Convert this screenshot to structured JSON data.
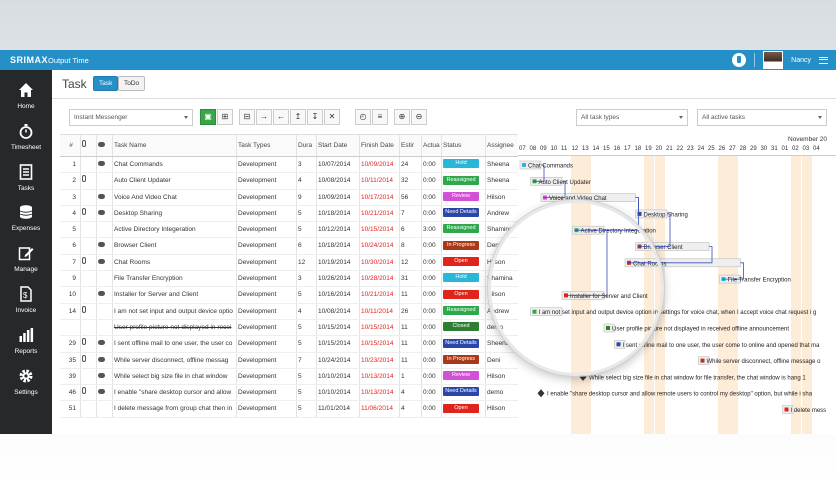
{
  "header": {
    "brand": "SRIMAX",
    "app_name": "Output Time",
    "user_name": "Nancy",
    "bell_icon": "notification-icon",
    "menu_icon": "hamburger-icon"
  },
  "sidebar": {
    "items": [
      {
        "label": "Home",
        "icon": "home-icon"
      },
      {
        "label": "Timesheet",
        "icon": "stopwatch-icon"
      },
      {
        "label": "Tasks",
        "icon": "tasks-icon"
      },
      {
        "label": "Expenses",
        "icon": "coins-icon"
      },
      {
        "label": "Manage",
        "icon": "edit-icon"
      },
      {
        "label": "Invoice",
        "icon": "invoice-icon"
      },
      {
        "label": "Reports",
        "icon": "bar-chart-icon"
      },
      {
        "label": "Settings",
        "icon": "gear-icon"
      }
    ]
  },
  "page": {
    "title": "Task",
    "tabs": [
      {
        "label": "Task",
        "active": true
      },
      {
        "label": "ToDo",
        "active": false
      }
    ]
  },
  "filters": {
    "project": "Instant Messenger",
    "task_types": "All task types",
    "task_status": "All active tasks"
  },
  "toolbar": {
    "buttons": [
      "save-icon",
      "export-icon",
      "print-icon",
      "indent-icon",
      "outdent-icon",
      "move-up-icon",
      "move-down-icon",
      "delete-icon",
      "clock-icon",
      "gantt-icon",
      "zoom-in-icon",
      "zoom-out-icon"
    ],
    "glyphs": [
      "▣",
      "⊞",
      "⊟",
      "→",
      "←",
      "↥",
      "↧",
      "✕",
      "◴",
      "≡",
      "⊕",
      "⊖"
    ]
  },
  "grid": {
    "columns": [
      "#",
      "",
      "",
      "Task Name",
      "Task Types",
      "Dura",
      "Start Date",
      "Finish Date",
      "Estir",
      "Actua",
      "Status",
      "Assignee"
    ],
    "rows": [
      {
        "id": "1",
        "clip": false,
        "chat": true,
        "name": "Chat Commands",
        "type": "Development",
        "dur": "3",
        "start": "10/07/2014",
        "finish": "10/09/2014",
        "est": "24",
        "actual": "0:00",
        "status": "Hold",
        "assignee": "Sheena",
        "strike": false
      },
      {
        "id": "2",
        "clip": true,
        "chat": false,
        "name": "Auto Client Updater",
        "type": "Development",
        "dur": "4",
        "start": "10/08/2014",
        "finish": "10/11/2014",
        "est": "32",
        "actual": "0:00",
        "status": "Reassigned",
        "assignee": "Sheena",
        "strike": false
      },
      {
        "id": "3",
        "clip": false,
        "chat": true,
        "name": "Voice And Video Chat",
        "type": "Development",
        "dur": "9",
        "start": "10/09/2014",
        "finish": "10/17/2014",
        "est": "56",
        "actual": "0:00",
        "status": "Review",
        "assignee": "Hilson",
        "strike": false
      },
      {
        "id": "4",
        "clip": true,
        "chat": true,
        "name": "Desktop Sharing",
        "type": "Development",
        "dur": "5",
        "start": "10/18/2014",
        "finish": "10/21/2014",
        "est": "7",
        "actual": "0:00",
        "status": "Need Details",
        "assignee": "Andrew",
        "strike": false
      },
      {
        "id": "5",
        "clip": false,
        "chat": false,
        "name": "Active Directory Integeration",
        "type": "Development",
        "dur": "5",
        "start": "10/12/2014",
        "finish": "10/15/2014",
        "est": "6",
        "actual": "3:00",
        "status": "Reassigned",
        "assignee": "Shamina",
        "strike": false
      },
      {
        "id": "6",
        "clip": false,
        "chat": true,
        "name": "Browser Client",
        "type": "Development",
        "dur": "6",
        "start": "10/18/2014",
        "finish": "10/24/2014",
        "est": "8",
        "actual": "0:00",
        "status": "In Progress",
        "assignee": "Deni",
        "strike": false
      },
      {
        "id": "7",
        "clip": true,
        "chat": true,
        "name": "Chat Rooms",
        "type": "Development",
        "dur": "12",
        "start": "10/19/2014",
        "finish": "10/30/2014",
        "est": "12",
        "actual": "0:00",
        "status": "Open",
        "assignee": "Hilson",
        "strike": false
      },
      {
        "id": "9",
        "clip": false,
        "chat": false,
        "name": "File Transfer Encryption",
        "type": "Development",
        "dur": "3",
        "start": "10/26/2014",
        "finish": "10/28/2014",
        "est": "31",
        "actual": "0:00",
        "status": "Hold",
        "assignee": "Shamina",
        "strike": false
      },
      {
        "id": "10",
        "clip": false,
        "chat": true,
        "name": "Installer for Server and Client",
        "type": "Development",
        "dur": "5",
        "start": "10/16/2014",
        "finish": "10/21/2014",
        "est": "11",
        "actual": "0:00",
        "status": "Open",
        "assignee": "Hilson",
        "strike": false
      },
      {
        "id": "14",
        "clip": true,
        "chat": false,
        "name": "I am not set input and output device optio",
        "type": "Development",
        "dur": "4",
        "start": "10/08/2014",
        "finish": "10/11/2014",
        "est": "26",
        "actual": "0:00",
        "status": "Reassigned",
        "assignee": "Andrew",
        "strike": false
      },
      {
        "id": "",
        "clip": false,
        "chat": false,
        "name": "User profile picture not displayed in recei",
        "type": "Development",
        "dur": "5",
        "start": "10/15/2014",
        "finish": "10/15/2014",
        "est": "11",
        "actual": "0:00",
        "status": "Closed",
        "assignee": "demo",
        "strike": true
      },
      {
        "id": "29",
        "clip": true,
        "chat": true,
        "name": "I sent offline mail to one user, the user co",
        "type": "Development",
        "dur": "5",
        "start": "10/15/2014",
        "finish": "10/15/2014",
        "est": "11",
        "actual": "0:00",
        "status": "Need Details",
        "assignee": "Sheena",
        "strike": false
      },
      {
        "id": "35",
        "clip": true,
        "chat": true,
        "name": "While server disconnect, offline messag",
        "type": "Development",
        "dur": "7",
        "start": "10/24/2014",
        "finish": "10/23/2014",
        "est": "11",
        "actual": "0:00",
        "status": "In Progress",
        "assignee": "Deni",
        "strike": false
      },
      {
        "id": "39",
        "clip": false,
        "chat": true,
        "name": "While select big size file in chat window",
        "type": "Development",
        "dur": "5",
        "start": "10/10/2014",
        "finish": "10/13/2014",
        "est": "1",
        "actual": "0:00",
        "status": "Review",
        "assignee": "Hilson",
        "strike": false
      },
      {
        "id": "46",
        "clip": true,
        "chat": true,
        "name": "I enable \"share desktop cursor and allow",
        "type": "Development",
        "dur": "5",
        "start": "10/10/2014",
        "finish": "10/13/2014",
        "est": "4",
        "actual": "0:00",
        "status": "Need Details",
        "assignee": "demo",
        "strike": false
      },
      {
        "id": "51",
        "clip": false,
        "chat": false,
        "name": "I delete message from group chat then in",
        "type": "Development",
        "dur": "5",
        "start": "11/01/2014",
        "finish": "11/06/2014",
        "est": "4",
        "actual": "0:00",
        "status": "Open",
        "assignee": "Hilson",
        "strike": false
      }
    ]
  },
  "status_colors": {
    "Hold": "#29b6d8",
    "Reassigned": "#2ea84a",
    "Review": "#d24fd8",
    "Need Details": "#2a47a8",
    "In Progress": "#a83a1a",
    "Open": "#e0241c",
    "Closed": "#2e7d32"
  },
  "gantt": {
    "month_label": "November 20",
    "days": [
      "07",
      "08",
      "09",
      "10",
      "11",
      "12",
      "13",
      "14",
      "15",
      "16",
      "17",
      "18",
      "19",
      "20",
      "21",
      "22",
      "23",
      "24",
      "25",
      "26",
      "27",
      "28",
      "29",
      "30",
      "31",
      "01",
      "02",
      "03",
      "04"
    ],
    "bars": [
      {
        "row": 0,
        "label": "Chat Commands",
        "color": "#29b6d8",
        "start": 0,
        "len": 2
      },
      {
        "row": 1,
        "label": "Auto Client Updater",
        "color": "#2ea84a",
        "start": 1,
        "len": 3
      },
      {
        "row": 2,
        "label": "Voice and Video Chat",
        "color": "#d24fd8",
        "start": 2,
        "len": 9
      },
      {
        "row": 3,
        "label": "Desktop Sharing",
        "color": "#2a47a8",
        "start": 11,
        "len": 3
      },
      {
        "row": 4,
        "label": "Active Directory Integeration",
        "color": "#2ea84a",
        "start": 5,
        "len": 3
      },
      {
        "row": 5,
        "label": "Browser Client",
        "color": "#a83a1a",
        "start": 11,
        "len": 7
      },
      {
        "row": 6,
        "label": "Chat Rooms",
        "color": "#e0241c",
        "start": 10,
        "len": 11
      },
      {
        "row": 7,
        "label": "File Transfer Encryption",
        "color": "#29b6d8",
        "start": 19,
        "len": 2
      },
      {
        "row": 8,
        "label": "Installer for Server and Client",
        "color": "#e0241c",
        "start": 4,
        "len": 4
      },
      {
        "row": 9,
        "label": "I am not set input and output device option in settings for voice chat, when I accept voice chat request i g",
        "color": "#2ea84a",
        "start": 1,
        "len": 3
      },
      {
        "row": 10,
        "label": "User profile picture not displayed in received offline announcement",
        "color": "#2e7d32",
        "start": 8,
        "len": 1
      },
      {
        "row": 11,
        "label": "I sent offline mail to one user, the user come to online and opened that ma",
        "color": "#2a47a8",
        "start": 9,
        "len": 1
      },
      {
        "row": 12,
        "label": "While server disconnect, offline message o",
        "color": "#a83a1a",
        "start": 17,
        "len": 1
      },
      {
        "row": 13,
        "label": "While select big size file in chat window for file transfer, the chat window is hang 1 ",
        "color": "#d24fd8",
        "start": 6,
        "len": 0
      },
      {
        "row": 14,
        "label": "I enable \"share desktop cursor and allow remote users to control my desktop\" option, but while i sha",
        "color": "#2a47a8",
        "start": 2,
        "len": 0
      },
      {
        "row": 15,
        "label": "I delete mess",
        "color": "#e0241c",
        "start": 25,
        "len": 1
      }
    ]
  }
}
